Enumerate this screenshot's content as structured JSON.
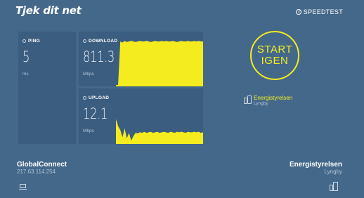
{
  "header": {
    "brand": "Tjek dit net",
    "speedtest_label": "SPEEDTEST"
  },
  "ping": {
    "label": "PING",
    "value": "5",
    "unit": "ms"
  },
  "download": {
    "label": "DOWNLOAD",
    "value": "811.3",
    "unit": "Mbps",
    "graph": [
      0.02,
      0.03,
      0.82,
      0.8,
      0.83,
      0.81,
      0.82,
      0.83,
      0.82,
      0.81,
      0.82,
      0.83,
      0.82,
      0.82,
      0.83,
      0.82,
      0.81,
      0.82,
      0.83,
      0.82,
      0.82,
      0.83,
      0.82,
      0.83,
      0.82,
      0.82,
      0.83,
      0.82,
      0.81,
      0.82,
      0.83,
      0.82,
      0.82,
      0.83,
      0.82,
      0.82,
      0.83,
      0.82,
      0.83,
      0.82,
      0.82
    ]
  },
  "upload": {
    "label": "UPLOAD",
    "value": "12.1",
    "unit": "Mbps",
    "graph": [
      0.45,
      0.32,
      0.25,
      0.12,
      0.28,
      0.1,
      0.2,
      0.06,
      0.14,
      0.2,
      0.19,
      0.21,
      0.2,
      0.22,
      0.2,
      0.21,
      0.22,
      0.2,
      0.21,
      0.22,
      0.2,
      0.21,
      0.22,
      0.21,
      0.2,
      0.22,
      0.21,
      0.2,
      0.22,
      0.21,
      0.22,
      0.21,
      0.2,
      0.22,
      0.21,
      0.21,
      0.22,
      0.21,
      0.22,
      0.2,
      0.21
    ]
  },
  "start_button": {
    "label": "START\nIGEN"
  },
  "server": {
    "name": "Energistyrelsen",
    "city": "Lyngby"
  },
  "isp": {
    "name": "GlobalConnect",
    "ip": "217.63.114.254"
  },
  "host": {
    "name": "Energistyrelsen",
    "city": "Lyngby"
  },
  "colors": {
    "accent": "#f5ec1f",
    "background": "#44688a",
    "panel": "#3b5d80"
  },
  "icons": {
    "speedtest": "speedometer-icon",
    "metric": "ring-icon",
    "server": "server-icon",
    "laptop": "laptop-icon"
  }
}
